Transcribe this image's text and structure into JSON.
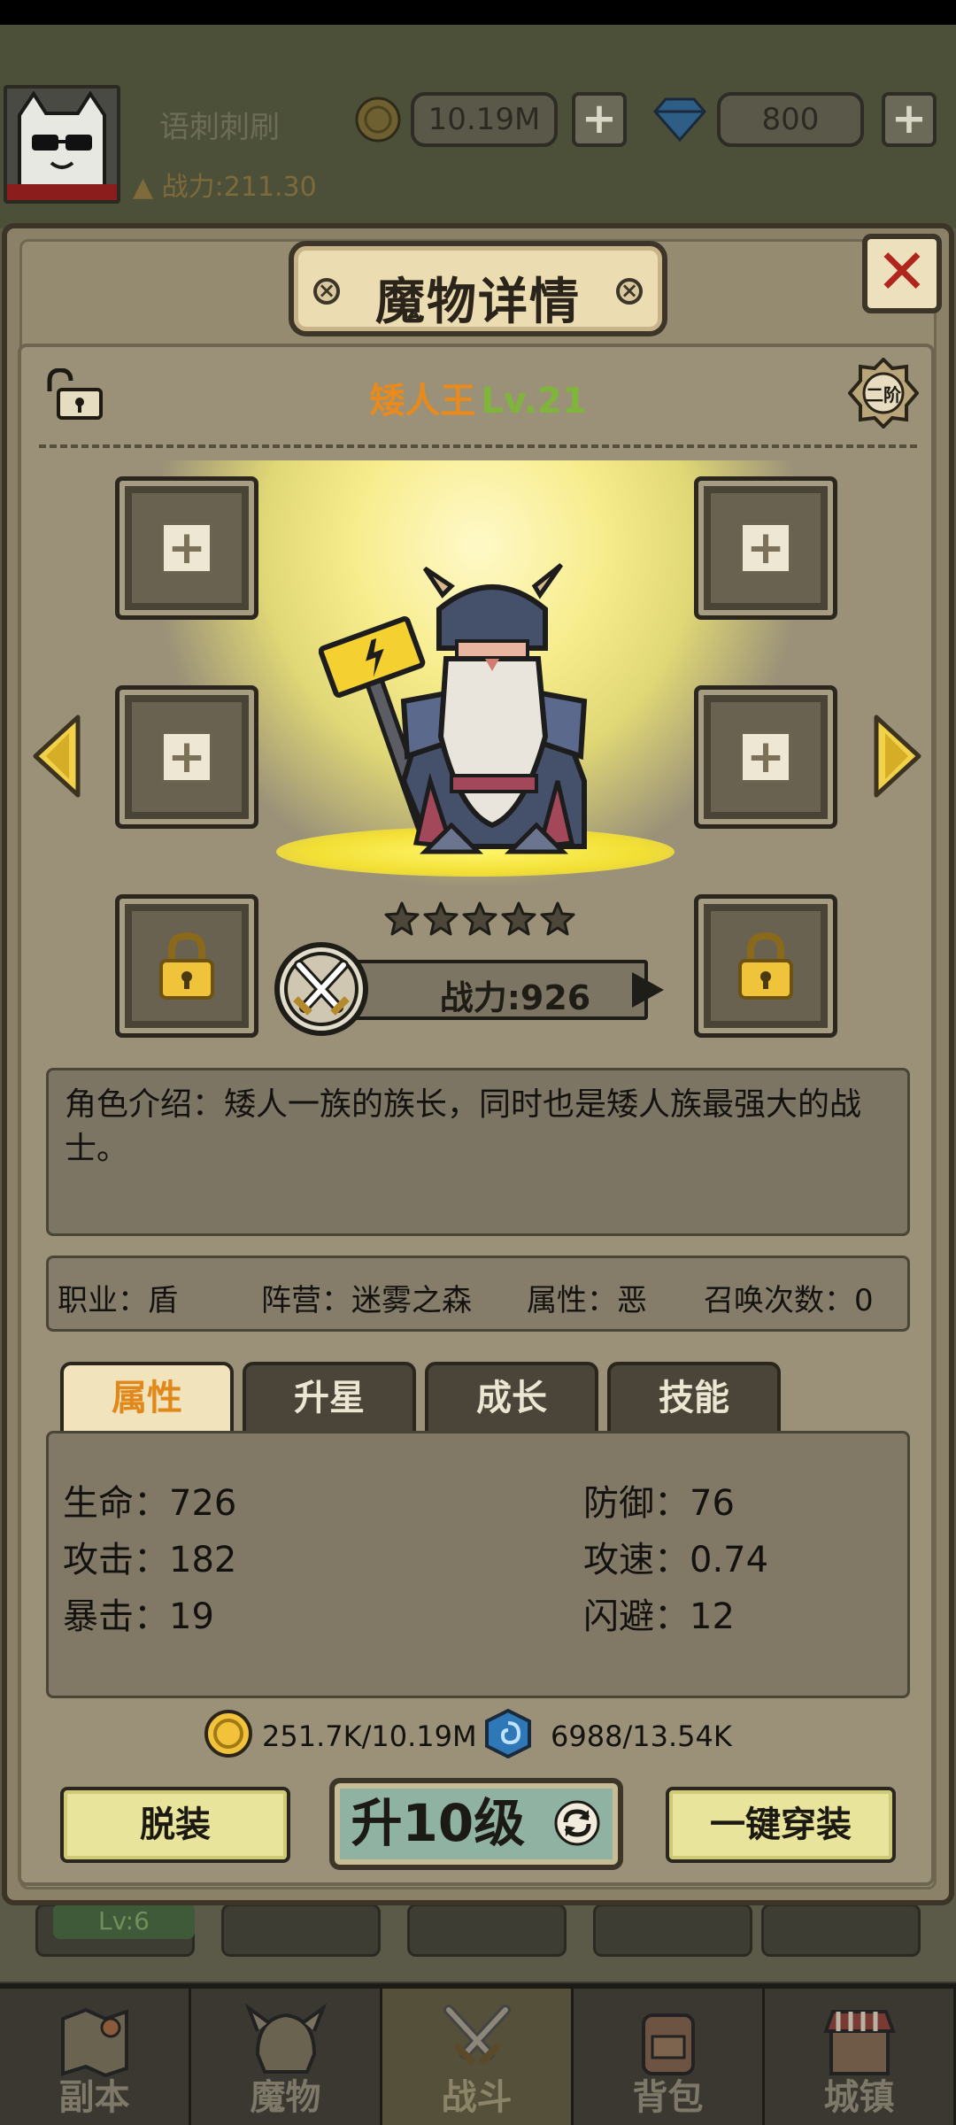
{
  "hud": {
    "player_name": "语刺刺刷",
    "power_label": "战力:211.30",
    "gold_value": "10.19M",
    "diamond_value": "800",
    "plus_symbol": "+"
  },
  "panel": {
    "title": "魔物详情",
    "close_symbol": "✕"
  },
  "monster": {
    "name": "矮人王",
    "level": "Lv.21",
    "tier_badge": "二阶",
    "stars": 5,
    "power": "战力:926",
    "description": "角色介绍：矮人一族的族长，同时也是矮人族最强大的战士。",
    "meta": {
      "job": "职业：盾",
      "camp": "阵营：迷雾之森",
      "attribute": "属性：恶",
      "summons": "召唤次数：0"
    }
  },
  "equip_slots": {
    "plus_symbol": "+"
  },
  "tabs": [
    {
      "label": "属性",
      "active": true
    },
    {
      "label": "升星",
      "active": false
    },
    {
      "label": "成长",
      "active": false
    },
    {
      "label": "技能",
      "active": false
    }
  ],
  "stats": {
    "hp": "生命：726",
    "def": "防御：76",
    "atk": "攻击：182",
    "spd": "攻速：0.74",
    "crit": "暴击：19",
    "dodge": "闪避：12"
  },
  "costs": {
    "gold": "251.7K/10.19M",
    "essence": "6988/13.54K"
  },
  "actions": {
    "unequip": "脱装",
    "upgrade": "升10级",
    "equip_all": "一键穿装"
  },
  "bottom_nav": [
    {
      "label": "副本",
      "icon": "map-icon",
      "active": false
    },
    {
      "label": "魔物",
      "icon": "monster-helmet-icon",
      "active": false
    },
    {
      "label": "战斗",
      "icon": "crossed-swords-icon",
      "active": true
    },
    {
      "label": "背包",
      "icon": "backpack-icon",
      "active": false
    },
    {
      "label": "城镇",
      "icon": "town-icon",
      "active": false
    }
  ],
  "behind": {
    "slot_level": "Lv:6"
  },
  "colors": {
    "accent_orange": "#e98a1c",
    "level_green": "#7fb53a",
    "close_red": "#b0251c",
    "tab_active_bg": "#f1e4bd",
    "button_yellow": "#e8e49b",
    "upgrade_teal": "#8fb2a3"
  }
}
